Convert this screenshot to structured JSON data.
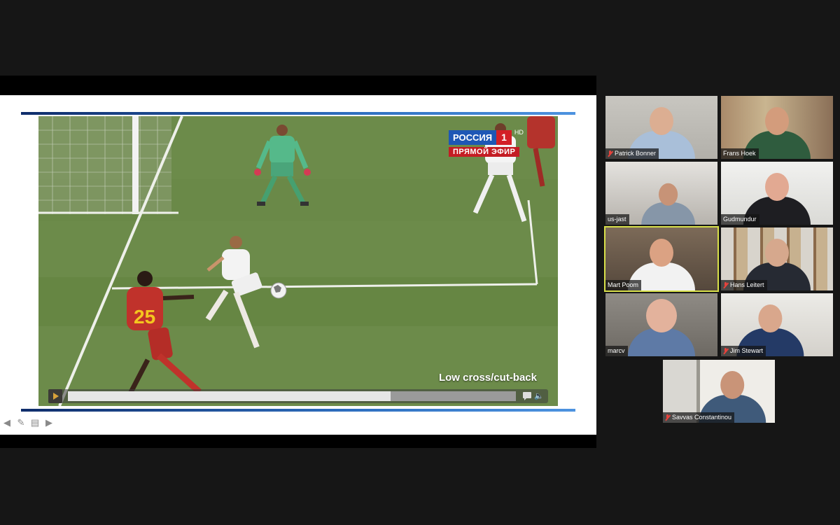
{
  "shared_screen": {
    "video": {
      "channel_name": "РОССИЯ",
      "channel_number": "1",
      "channel_hd": "HD",
      "live_label": "ПРЯМОЙ ЭФИР",
      "caption": "Low cross/cut-back",
      "player_number": "25",
      "progress": 0.72
    },
    "slide_nav": {
      "icons": [
        "arrow-left-icon",
        "pen-icon",
        "slides-icon",
        "arrow-right-icon"
      ]
    }
  },
  "participants": [
    {
      "name": "Patrick Bonner",
      "muted": true
    },
    {
      "name": "Frans Hoek",
      "muted": false
    },
    {
      "name": "us-jast",
      "muted": false
    },
    {
      "name": "Gudmundur",
      "muted": false
    },
    {
      "name": "Mart Poom",
      "muted": false,
      "active_speaker": true
    },
    {
      "name": "Hans Leitert",
      "muted": true
    },
    {
      "name": "marcv",
      "muted": false
    },
    {
      "name": "Jim Stewart",
      "muted": true
    },
    {
      "name": "Savvas Constantinou",
      "muted": true
    }
  ],
  "colors": {
    "background": "#161616",
    "active_speaker_border": "#d8e04a",
    "muted_icon": "#e8423c",
    "slide_rule": "#2e6fc0"
  }
}
